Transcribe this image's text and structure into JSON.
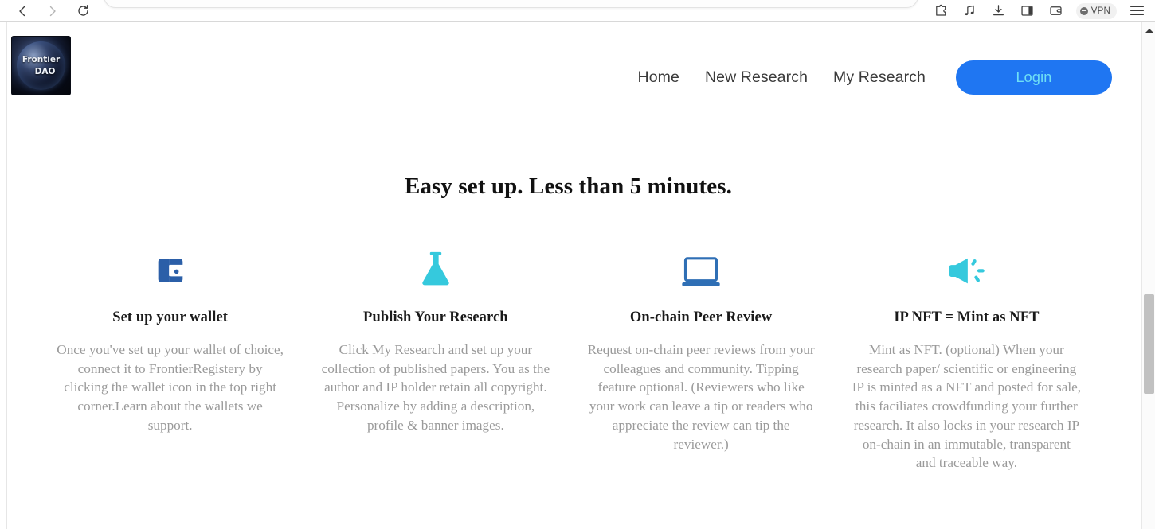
{
  "browser": {
    "back_icon": "chevron-left-icon",
    "forward_icon": "chevron-right-icon",
    "reload_icon": "reload-icon",
    "address_value": "",
    "address_placeholder": "",
    "toolbar_icons": [
      {
        "name": "extensions-icon",
        "label": "Extensions"
      },
      {
        "name": "music-note-icon",
        "label": "Media"
      },
      {
        "name": "download-icon",
        "label": "Downloads"
      },
      {
        "name": "sidebar-panel-icon",
        "label": "Sidebar"
      },
      {
        "name": "wallet-icon",
        "label": "Wallet"
      }
    ],
    "vpn_label": "VPN",
    "menu_icon": "hamburger-menu-icon"
  },
  "site": {
    "logo": {
      "line1": "Frontier",
      "line2": "DAO",
      "alt": "Frontier DAO globe logo"
    },
    "nav": [
      {
        "label": "Home"
      },
      {
        "label": "New Research"
      },
      {
        "label": "My Research"
      }
    ],
    "login_label": "Login",
    "login_color": "#1f76f2",
    "login_text_color": "#6fe0f5"
  },
  "hero": {
    "title": "Easy set up. Less than 5 minutes."
  },
  "features": [
    {
      "icon": "wallet-icon",
      "icon_color": "#2b5fa8",
      "title": "Set up your wallet",
      "body": "Once you've set up your wallet of choice, connect it to FrontierRegistery by clicking the wallet icon in the top right corner.Learn about the wallets we support."
    },
    {
      "icon": "flask-icon",
      "icon_color": "#2ec7dd",
      "title": "Publish Your Research",
      "body": "Click My Research and set up your collection of published papers. You as the author and IP holder retain all copyright. Personalize by adding a description, profile & banner images."
    },
    {
      "icon": "laptop-icon",
      "icon_color": "#2f6fb5",
      "title": "On-chain Peer Review",
      "body": "Request on-chain peer reviews from your colleagues and community. Tipping feature optional. (Reviewers who like your work can leave a tip or readers who appreciate the review can tip the reviewer.)"
    },
    {
      "icon": "megaphone-icon",
      "icon_color": "#2ec7dd",
      "title": "IP NFT = Mint as NFT",
      "body": "Mint as NFT. (optional) When your research paper/ scientific or engineering IP is minted as a NFT and posted for sale, this faciliates crowdfunding your further research. It also locks in your research IP on-chain in an immutable, transparent and traceable way."
    }
  ],
  "scrollbar": {
    "up_arrow": "scroll-up-arrow-icon"
  }
}
